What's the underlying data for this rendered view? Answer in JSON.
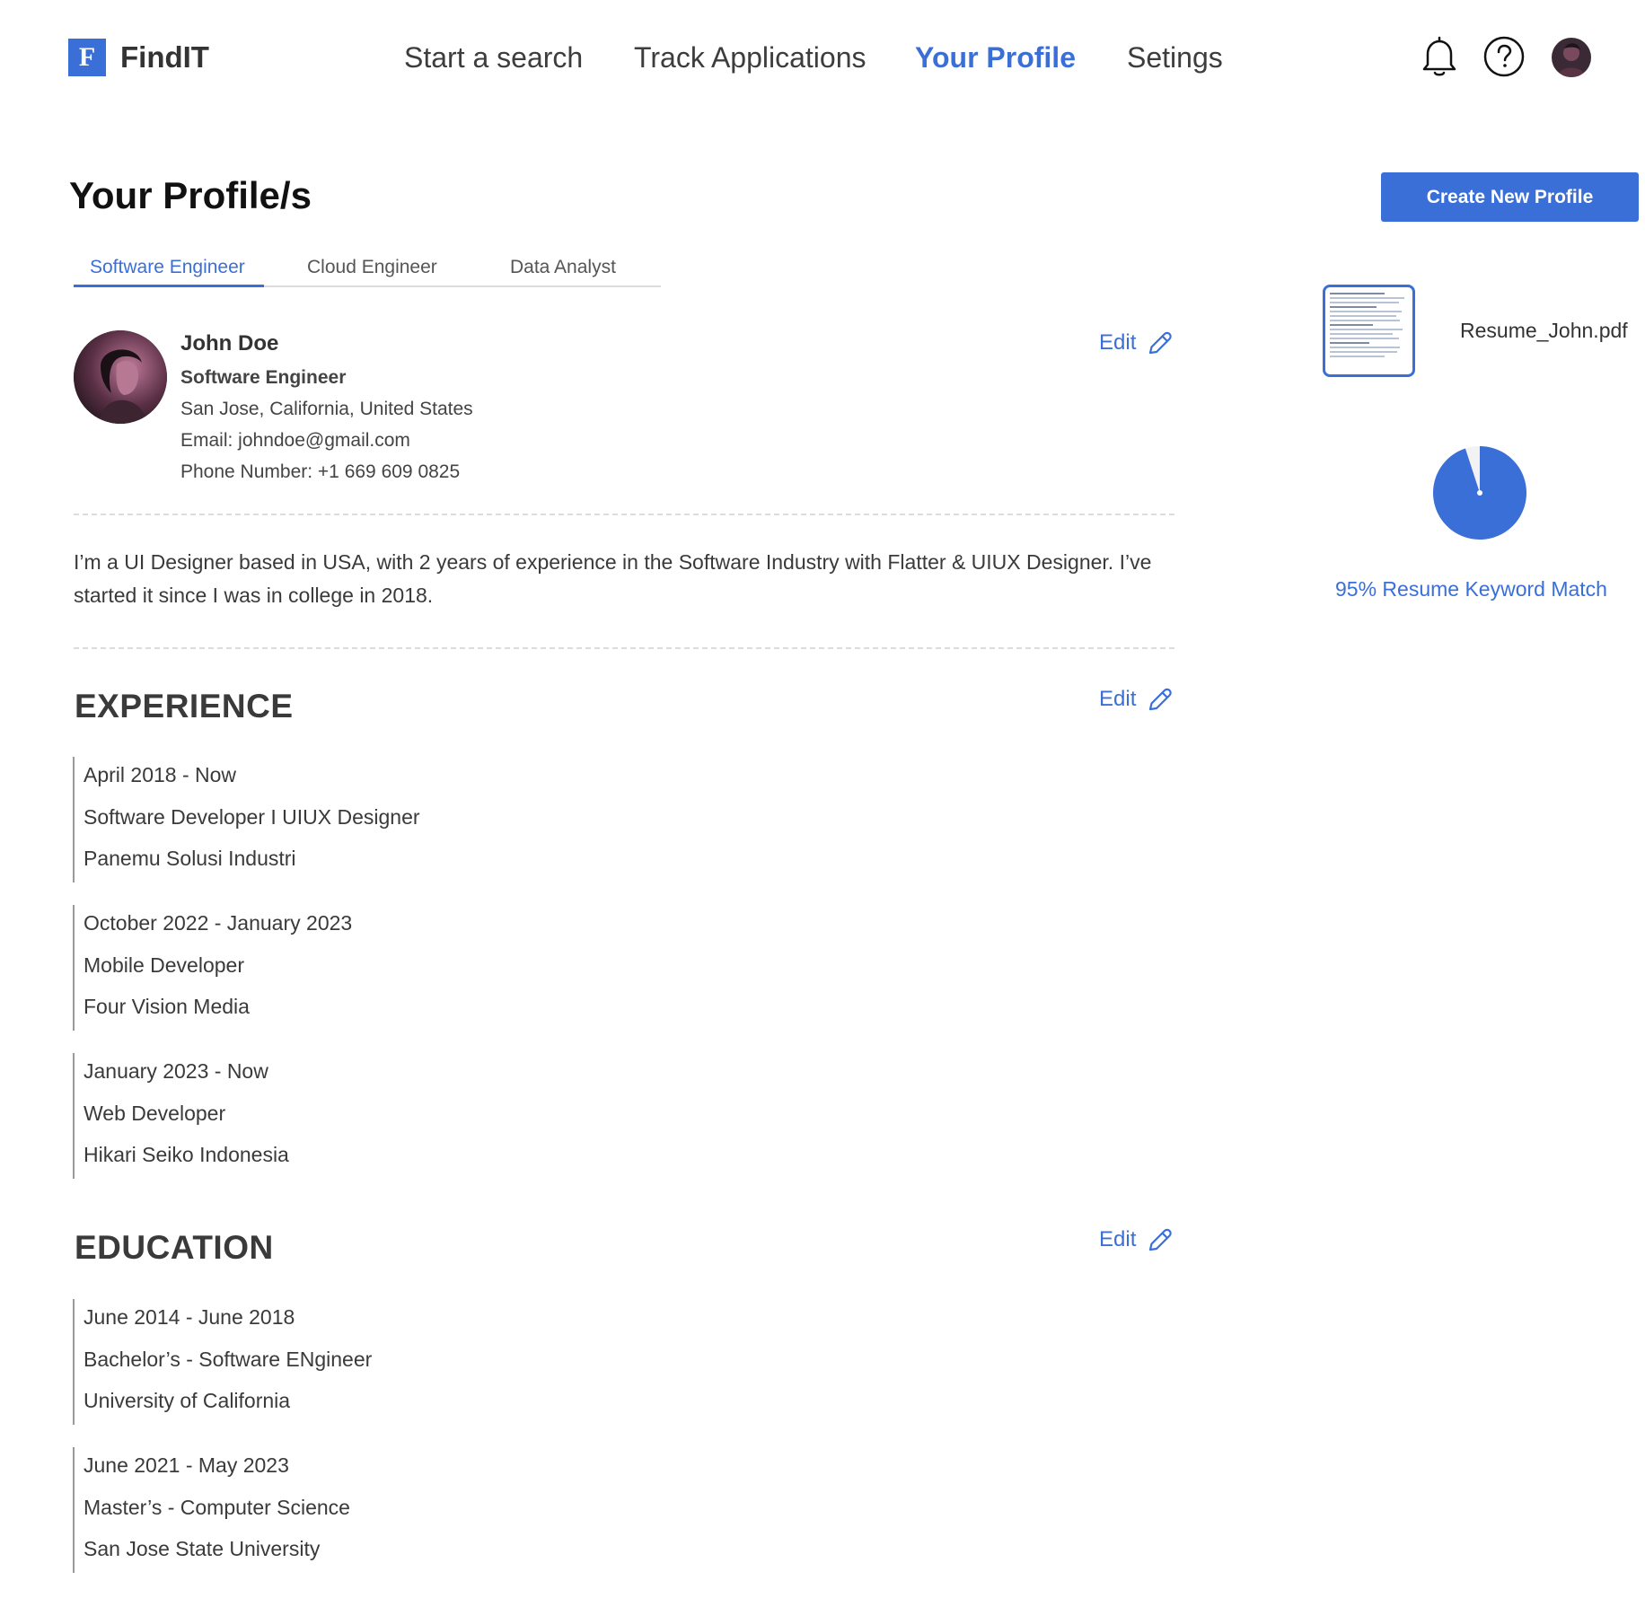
{
  "brand": {
    "logo_letter": "F",
    "name": "FindIT",
    "accent": "#3b6fd8"
  },
  "nav": [
    {
      "label": "Start a search",
      "active": false
    },
    {
      "label": "Track Applications",
      "active": false
    },
    {
      "label": "Your Profile",
      "active": true
    },
    {
      "label": "Setings",
      "active": false
    }
  ],
  "header_icons": [
    "bell-icon",
    "help-icon",
    "user-avatar"
  ],
  "page": {
    "title": "Your Profile/s",
    "create_button": "Create New Profile"
  },
  "tabs": [
    {
      "label": "Software Engineer",
      "active": true
    },
    {
      "label": "Cloud Engineer",
      "active": false
    },
    {
      "label": "Data Analyst",
      "active": false
    }
  ],
  "profile": {
    "name": "John Doe",
    "title": "Software Engineer",
    "location": "San Jose, California, United States",
    "email": "Email: johndoe@gmail.com",
    "phone": "Phone Number: +1 669 609 0825",
    "bio": "I’m a UI Designer based in USA, with 2 years of experience in the Software Industry with Flatter & UIUX Designer.  I’ve started it since I was in college in 2018."
  },
  "edit_label": "Edit",
  "experience": {
    "title": "EXPERIENCE",
    "items": [
      {
        "dates": "April 2018 - Now",
        "role": "Software Developer I UIUX Designer",
        "company": "Panemu Solusi Industri"
      },
      {
        "dates": "October 2022 - January 2023",
        "role": "Mobile Developer",
        "company": "Four Vision Media"
      },
      {
        "dates": "January 2023 - Now",
        "role": "Web Developer",
        "company": "Hikari Seiko Indonesia"
      }
    ]
  },
  "education": {
    "title": "EDUCATION",
    "items": [
      {
        "dates": "June 2014 - June 2018",
        "degree": "Bachelor’s - Software ENgineer",
        "school": "University of California"
      },
      {
        "dates": "June 2021 - May 2023",
        "degree": "Master’s - Computer Science",
        "school": "San Jose State University"
      }
    ]
  },
  "resume": {
    "filename": "Resume_John.pdf",
    "icon": "pdf-thumbnail"
  },
  "keyword_match": {
    "percent": 95,
    "label": "95% Resume Keyword Match",
    "color": "#3b6fd8"
  }
}
